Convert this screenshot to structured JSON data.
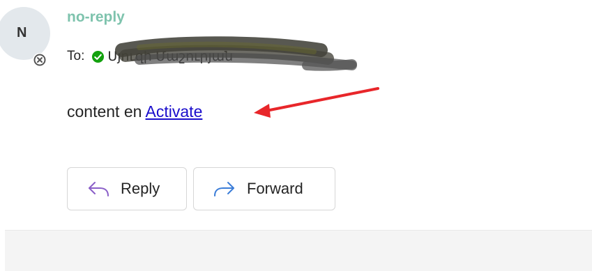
{
  "sender": {
    "avatar_initial": "N",
    "name": "no-reply"
  },
  "recipients": {
    "to_label": "To:",
    "name": "Սյուզի Մաշուրյան",
    "status": "available"
  },
  "message": {
    "body_text": "content en ",
    "link_text": "Activate"
  },
  "actions": {
    "reply_label": "Reply",
    "forward_label": "Forward"
  },
  "colors": {
    "sender_name": "#7ec3ad",
    "link": "#1a0dcc",
    "presence_available": "#13a10e",
    "reply_icon": "#8a5fc8",
    "forward_icon": "#3b7dd8",
    "annotation_arrow": "#e8262a"
  }
}
